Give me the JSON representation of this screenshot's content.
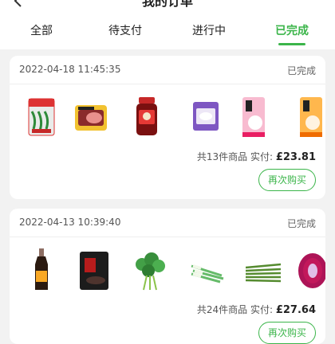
{
  "header": {
    "title": "我的订单"
  },
  "tabs": [
    {
      "label": "全部"
    },
    {
      "label": "待支付"
    },
    {
      "label": "进行中"
    },
    {
      "label": "已完成"
    }
  ],
  "orders": [
    {
      "datetime": "2022-04-18 11:45:35",
      "status": "已完成",
      "count_text": "共13件商品",
      "paid_label": "实付:",
      "amount": "£23.81",
      "rebuy_label": "再次购买"
    },
    {
      "datetime": "2022-04-13 10:39:40",
      "status": "已完成",
      "count_text": "共24件商品",
      "paid_label": "实付:",
      "amount": "£27.64",
      "rebuy_label": "再次购买"
    }
  ],
  "colors": {
    "accent": "#3bb54a",
    "background": "#f2f2f2"
  }
}
